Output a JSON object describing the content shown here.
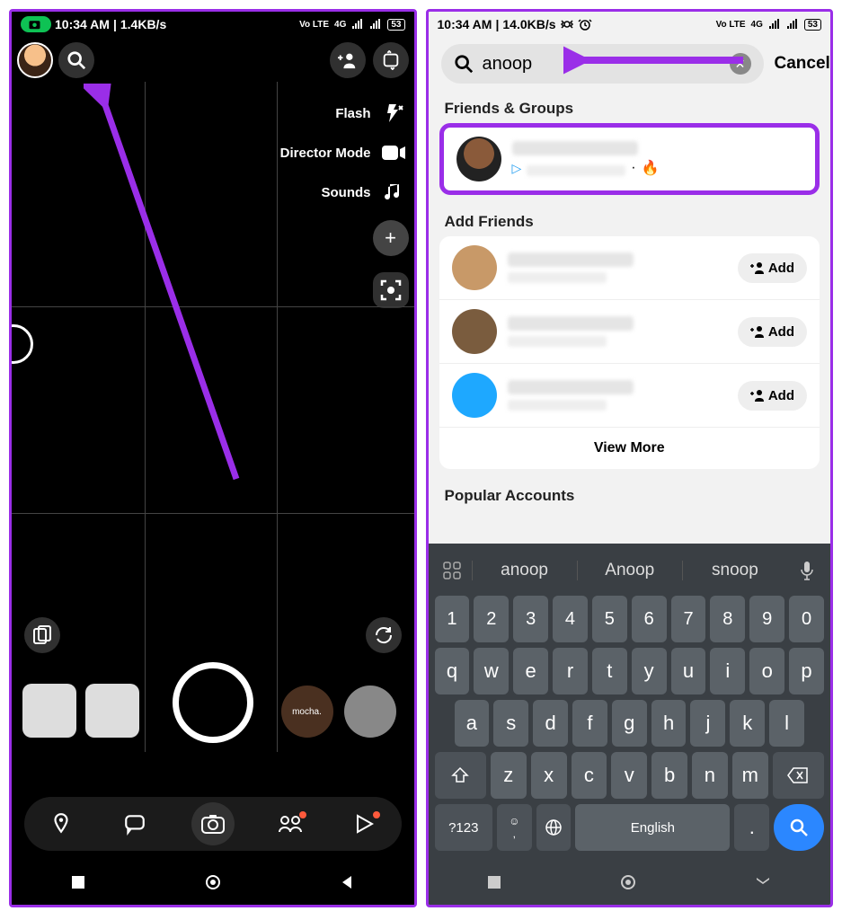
{
  "left": {
    "status": {
      "time": "10:34 AM",
      "net": "1.4KB/s",
      "volte": "Vo LTE",
      "sig": "4G",
      "batt": "53"
    },
    "side": {
      "flash": "Flash",
      "director": "Director Mode",
      "sounds": "Sounds"
    },
    "lens": {
      "mocha": "mocha."
    }
  },
  "right": {
    "status": {
      "time": "10:34 AM",
      "net": "14.0KB/s",
      "volte": "Vo LTE",
      "sig": "4G",
      "batt": "53"
    },
    "search": {
      "value": "anoop",
      "cancel": "Cancel"
    },
    "sections": {
      "friends": "Friends & Groups",
      "add": "Add Friends",
      "popular": "Popular Accounts"
    },
    "add_label": "Add",
    "view_more": "View More",
    "keyboard": {
      "suggestions": [
        "anoop",
        "Anoop",
        "snoop"
      ],
      "row1": [
        "1",
        "2",
        "3",
        "4",
        "5",
        "6",
        "7",
        "8",
        "9",
        "0"
      ],
      "row2": [
        "q",
        "w",
        "e",
        "r",
        "t",
        "y",
        "u",
        "i",
        "o",
        "p"
      ],
      "row3": [
        "a",
        "s",
        "d",
        "f",
        "g",
        "h",
        "j",
        "k",
        "l"
      ],
      "row4": [
        "z",
        "x",
        "c",
        "v",
        "b",
        "n",
        "m"
      ],
      "sym": "?123",
      "comma": ",",
      "space": "English",
      "period": "."
    }
  }
}
